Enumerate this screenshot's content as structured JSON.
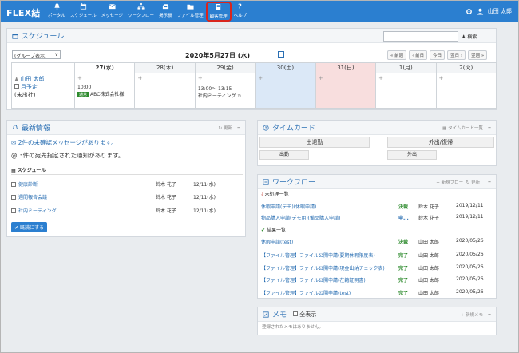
{
  "app": {
    "brand": "FLEX結"
  },
  "nav": [
    {
      "label": "ポータル",
      "icon": "bell-icon"
    },
    {
      "label": "スケジュール",
      "icon": "calendar-icon"
    },
    {
      "label": "メッセージ",
      "icon": "mail-icon"
    },
    {
      "label": "ワークフロー",
      "icon": "workflow-icon"
    },
    {
      "label": "掲示板",
      "icon": "board-icon"
    },
    {
      "label": "ファイル管理",
      "icon": "file-icon"
    },
    {
      "label": "顧客管理",
      "icon": "customer-icon"
    },
    {
      "label": "ヘルプ",
      "icon": "help-icon"
    }
  ],
  "user": {
    "name": "山田 太郎"
  },
  "schedule": {
    "title": "スケジュール",
    "search_label": "検索",
    "group_select": "(グループ表示)",
    "date_label": "2020年5月27日 (水)",
    "nav_buttons": [
      "前週",
      "前日",
      "今日",
      "翌日",
      "翌週"
    ],
    "days": [
      {
        "label": "27(水)"
      },
      {
        "label": "28(木)"
      },
      {
        "label": "29(金)"
      },
      {
        "label": "30(土)"
      },
      {
        "label": "31(日)"
      },
      {
        "label": "1(月)"
      },
      {
        "label": "2(火)"
      }
    ],
    "person": {
      "name": "山田 太郎",
      "month_link": "月予定",
      "status": "(未出社)"
    },
    "events": [
      {
        "time": "10:00",
        "tag": "通常",
        "title": "ABC株式会社様"
      },
      {
        "time": "13:00～ 13:15",
        "title": "社内ミーティング"
      }
    ]
  },
  "news": {
    "title": "最新情報",
    "refresh": "更新",
    "unread_msg": "2件の未確認メッセージがあります。",
    "notice": "3件の宛先指定された通知があります。",
    "section": "スケジュール",
    "rows": [
      {
        "title": "健康診断",
        "user": "鈴木 花子",
        "date": "12/11(水)"
      },
      {
        "title": "週間報告会議",
        "user": "鈴木 花子",
        "date": "12/11(水)"
      },
      {
        "title": "社内ミーティング",
        "user": "鈴木 花子",
        "date": "12/11(水)"
      }
    ],
    "read_button": "既読にする"
  },
  "timecard": {
    "title": "タイムカード",
    "list_link": "タイムカード一覧",
    "col1": "出退勤",
    "col2": "外出/復帰",
    "val1": "出勤",
    "val2": "外出"
  },
  "workflow": {
    "title": "ワークフロー",
    "new_flow": "新規フロー",
    "refresh": "更新",
    "pending_title": "未処理一覧",
    "done_title": "結果一覧",
    "pending": [
      {
        "title": "休暇申請(デモ)(休暇申請)",
        "status": "決裁",
        "user": "鈴木 花子",
        "date": "2019/12/11"
      },
      {
        "title": "物品購入申請(デモ用)(備品購入申請)",
        "status": "申...",
        "user": "鈴木 花子",
        "date": "2019/12/11"
      }
    ],
    "done": [
      {
        "title": "休暇申請(test)",
        "status": "決裁",
        "user": "山田 太郎",
        "date": "2020/05/26"
      },
      {
        "title": "【ファイル管理】ファイル公開申請(要期休暇限度表)",
        "status": "完了",
        "user": "山田 太郎",
        "date": "2020/05/26"
      },
      {
        "title": "【ファイル管理】ファイル公開申請(現金出納チェック表)",
        "status": "完了",
        "user": "山田 太郎",
        "date": "2020/05/26"
      },
      {
        "title": "【ファイル管理】ファイル公開申請(在籍証明書)",
        "status": "完了",
        "user": "山田 太郎",
        "date": "2020/05/26"
      },
      {
        "title": "【ファイル管理】ファイル公開申請(test)",
        "status": "完了",
        "user": "山田 太郎",
        "date": "2020/05/26"
      }
    ]
  },
  "memo": {
    "title": "メモ",
    "show_all": "全表示",
    "new_memo": "新規メモ",
    "empty": "登録されたメモはありません。"
  },
  "colors": {
    "header": "#2b7fd0",
    "active_outline": "#d9251d",
    "sat": "#dbe8f7",
    "sun": "#f8dede"
  }
}
